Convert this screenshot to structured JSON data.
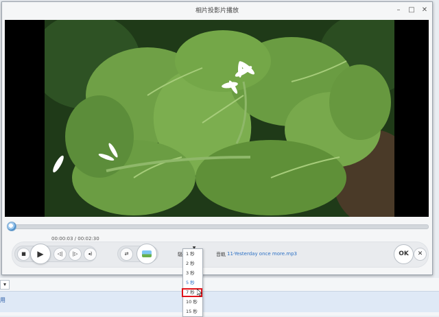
{
  "window": {
    "title": "相片投影片播放"
  },
  "controls": {
    "time_display": "00:00:03 / 00:02:30",
    "effect_label": "騷",
    "music_label": "音軌",
    "music_file": "11-Yesterday once more.mp3",
    "ok_label": "OK",
    "progress_fraction": 0.006
  },
  "dropdown": {
    "options": [
      "1 秒",
      "2 秒",
      "3 秒",
      "5 秒",
      "7 秒",
      "10 秒",
      "15 秒"
    ],
    "selected": "5 秒",
    "highlighted": "7 秒"
  },
  "background_app": {
    "tab_label": "▾",
    "strip_label": "用"
  },
  "icons": {
    "minimize": "minimize-icon",
    "maximize": "maximize-icon",
    "close": "close-icon",
    "stop": "stop-icon",
    "play": "play-icon",
    "prev": "previous-icon",
    "next": "next-icon",
    "speaker": "speaker-icon",
    "shuffle": "shuffle-icon",
    "music_thumb": "music-thumbnail-icon"
  }
}
